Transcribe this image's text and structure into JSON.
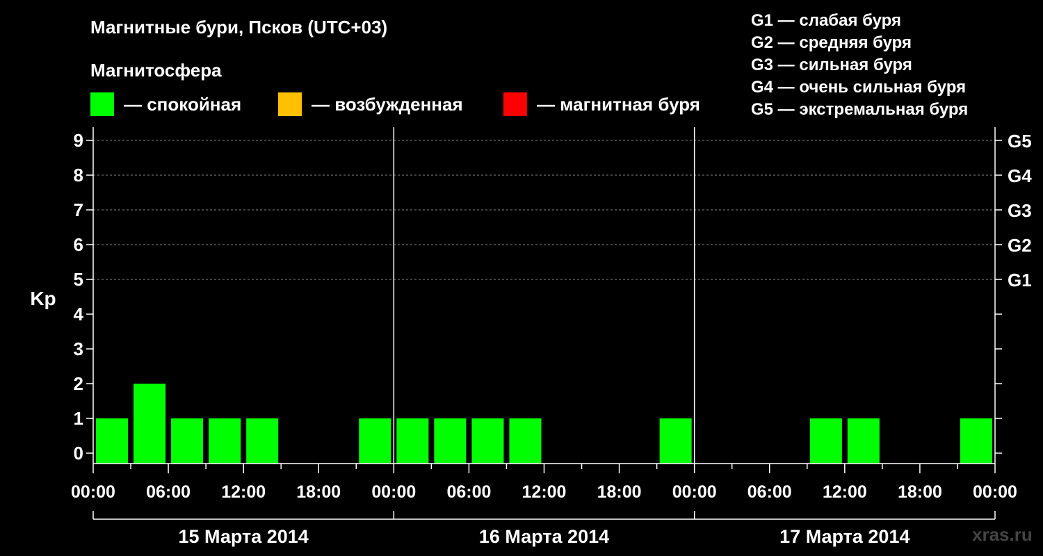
{
  "header": {
    "title": "Магнитные бури, Псков (UTC+03)",
    "subtitle": "Магнитосфера"
  },
  "legend": {
    "items": [
      {
        "label": "— спокойная",
        "color": "#00ff00"
      },
      {
        "label": "— возбужденная",
        "color": "#ffc000"
      },
      {
        "label": "— магнитная буря",
        "color": "#ff0000"
      }
    ]
  },
  "g_scale": [
    "G1 — слабая буря",
    "G2 — средняя буря",
    "G3 — сильная буря",
    "G4 — очень сильная буря",
    "G5 — экстремальная буря"
  ],
  "source": "xras.ru",
  "chart_data": {
    "type": "bar",
    "ylabel": "Kp",
    "ylim": [
      0,
      9
    ],
    "y_ticks": [
      "0",
      "1",
      "2",
      "3",
      "4",
      "5",
      "6",
      "7",
      "8",
      "9"
    ],
    "right_ticks": [
      {
        "value": 5,
        "label": "G1"
      },
      {
        "value": 6,
        "label": "G2"
      },
      {
        "value": 7,
        "label": "G3"
      },
      {
        "value": 8,
        "label": "G4"
      },
      {
        "value": 9,
        "label": "G5"
      }
    ],
    "grid": "dashed lines at Kp 5–9",
    "x_ticks": [
      "00:00",
      "06:00",
      "12:00",
      "18:00",
      "00:00",
      "06:00",
      "12:00",
      "18:00",
      "00:00",
      "06:00",
      "12:00",
      "18:00",
      "00:00"
    ],
    "days": [
      "15 Марта 2014",
      "16 Марта 2014",
      "17 Марта 2014"
    ],
    "interval_hours": 3,
    "values": [
      1,
      2,
      1,
      1,
      1,
      0,
      0,
      1,
      1,
      1,
      1,
      1,
      0,
      0,
      0,
      1,
      0,
      0,
      0,
      1,
      1,
      0,
      0,
      1
    ],
    "colors": {
      "quiet": "#00ff00",
      "disturbed": "#ffc000",
      "storm": "#ff0000"
    }
  }
}
